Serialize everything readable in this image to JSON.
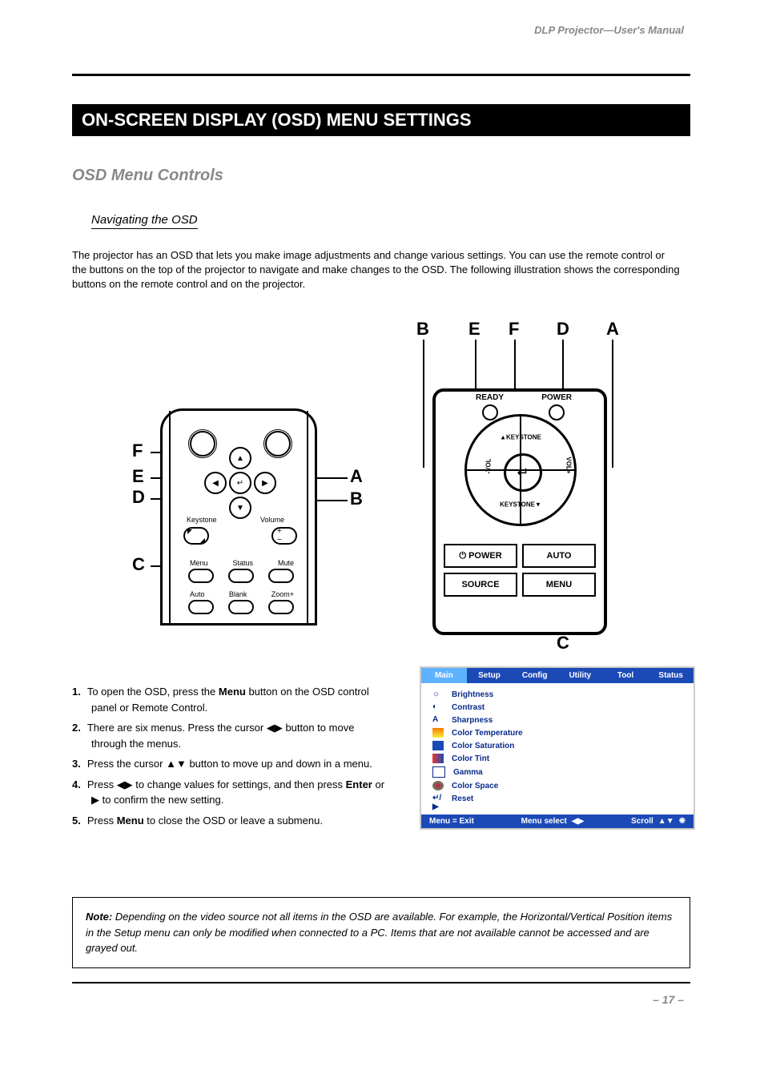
{
  "header": {
    "running": "DLP Projector—User's Manual"
  },
  "title_bar": "ON-SCREEN DISPLAY (OSD) MENU SETTINGS",
  "section": "OSD Menu Controls",
  "subsection": "Navigating the OSD",
  "intro": "The projector has an OSD that lets you make image adjustments and change various settings. You can use the remote control or the buttons on the top of the projector to navigate and make changes to the OSD. The following illustration shows the corresponding buttons on the remote control and on the projector.",
  "remote": {
    "row1_labels": [
      "Menu",
      "Status",
      "Mute"
    ],
    "row2_labels": [
      "Auto",
      "Blank",
      "Zoom+"
    ],
    "keystone": "Keystone",
    "volume": "Volume"
  },
  "panel": {
    "ready": "READY",
    "power_led": "POWER",
    "keystone_up": "KEYSTONE",
    "keystone_dn": "KEYSTONE",
    "vol_minus": "-VOL",
    "vol_plus": "VOL+",
    "power_btn": "⏻ POWER",
    "auto": "AUTO",
    "source": "SOURCE",
    "menu": "MENU"
  },
  "callouts": {
    "A": "A",
    "B": "B",
    "C": "C",
    "D": "D",
    "E": "E",
    "F": "F"
  },
  "steps": {
    "s1a": "To open the OSD, press the ",
    "s1b": "Menu",
    "s1c": " button on the OSD control panel or Remote Control.",
    "s2a": "There are six menus. Press the cursor ",
    "s2b": " button to move through the menus.",
    "s3a": "Press the cursor ",
    "s3b": " button to move up and down in a menu.",
    "s4a": "Press ",
    "s4b": " to change values for settings, and then press ",
    "s4c": "Enter",
    "s4d": " or ",
    "s4e": " to confirm the new setting.",
    "s5a": "Press ",
    "s5b": "Menu",
    "s5c": " to close the OSD or leave a submenu."
  },
  "osd": {
    "tabs": [
      "Main",
      "Setup",
      "Config",
      "Utility",
      "Tool",
      "Status"
    ],
    "items": [
      "Brightness",
      "Contrast",
      "Sharpness",
      "Color Temperature",
      "Color Saturation",
      "Color Tint",
      "Gamma",
      "Color Space",
      "Reset"
    ],
    "footer_exit": "Menu = Exit",
    "footer_select": "Menu select",
    "footer_scroll": "Scroll"
  },
  "note": {
    "label": "Note:",
    "body": " Depending on the video source not all items in the OSD are available. For example, the Horizontal/Vertical Position items in the Setup menu can only be modified when connected to a PC. Items that are not available cannot be accessed and are grayed out."
  },
  "footer": {
    "page": "– 17 –"
  },
  "icon_colors": {
    "brightness": "#888",
    "contrast": "#000",
    "sharpness": "#000",
    "colortemp": "#f57c00",
    "saturation": "#1b49b6",
    "tint": "#e53935",
    "gamma": "#000",
    "colorspace": "#c2185b",
    "reset": "#000"
  }
}
